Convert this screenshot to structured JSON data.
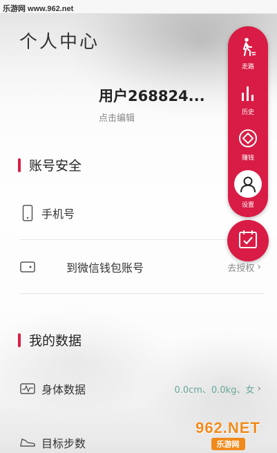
{
  "watermark": {
    "site": "乐游网 www.962.net",
    "logo": "962.NET",
    "logo_sub": "乐游网"
  },
  "header": {
    "title": "个人中心"
  },
  "profile": {
    "username": "用户268824...",
    "edit_hint": "点击编辑"
  },
  "sections": {
    "account_security": {
      "title": "账号安全",
      "items": [
        {
          "label": "手机号",
          "icon": "phone-icon",
          "value": ""
        },
        {
          "label": "到微信钱包账号",
          "icon": "wallet-icon",
          "value": "去授权"
        }
      ]
    },
    "my_data": {
      "title": "我的数据",
      "items": [
        {
          "label": "身体数据",
          "icon": "heart-rate-icon",
          "value": "0.0cm、0.0kg、女"
        },
        {
          "label": "目标步数",
          "icon": "shoe-icon",
          "value": ""
        }
      ]
    }
  },
  "nav": {
    "items": [
      {
        "label": "走路",
        "icon": "walk-icon"
      },
      {
        "label": "历史",
        "icon": "bar-chart-icon"
      },
      {
        "label": "赚钱",
        "icon": "diamond-coin-icon"
      },
      {
        "label": "设置",
        "icon": "user-icon",
        "active": true
      }
    ],
    "fab_icon": "calendar-check-icon"
  },
  "colors": {
    "accent": "#d91c45",
    "value_green": "#6aa79a",
    "watermark_orange": "#f08a1c"
  }
}
